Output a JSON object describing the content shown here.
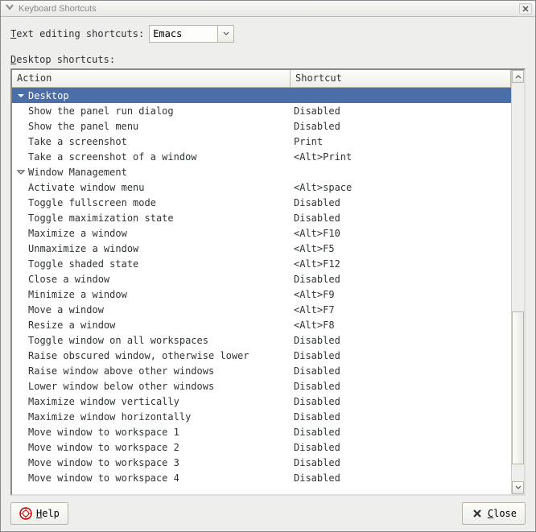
{
  "window": {
    "title": "Keyboard Shortcuts"
  },
  "editing": {
    "label": "Text editing shortcuts:",
    "dropdown_value": "Emacs"
  },
  "section": {
    "label": "Desktop shortcuts:"
  },
  "columns": {
    "action": "Action",
    "shortcut": "Shortcut"
  },
  "tree": [
    {
      "type": "group",
      "expanded": true,
      "selected": true,
      "label": "Desktop"
    },
    {
      "type": "item",
      "label": "Show the panel run dialog",
      "shortcut": "Disabled"
    },
    {
      "type": "item",
      "label": "Show the panel menu",
      "shortcut": "Disabled"
    },
    {
      "type": "item",
      "label": "Take a screenshot",
      "shortcut": "Print"
    },
    {
      "type": "item",
      "label": "Take a screenshot of a window",
      "shortcut": "<Alt>Print"
    },
    {
      "type": "group",
      "expanded": true,
      "selected": false,
      "label": "Window Management"
    },
    {
      "type": "item",
      "label": "Activate window menu",
      "shortcut": "<Alt>space"
    },
    {
      "type": "item",
      "label": "Toggle fullscreen mode",
      "shortcut": "Disabled"
    },
    {
      "type": "item",
      "label": "Toggle maximization state",
      "shortcut": "Disabled"
    },
    {
      "type": "item",
      "label": "Maximize a window",
      "shortcut": "<Alt>F10"
    },
    {
      "type": "item",
      "label": "Unmaximize a window",
      "shortcut": "<Alt>F5"
    },
    {
      "type": "item",
      "label": "Toggle shaded state",
      "shortcut": "<Alt>F12"
    },
    {
      "type": "item",
      "label": "Close a window",
      "shortcut": "Disabled"
    },
    {
      "type": "item",
      "label": "Minimize a window",
      "shortcut": "<Alt>F9"
    },
    {
      "type": "item",
      "label": "Move a window",
      "shortcut": "<Alt>F7"
    },
    {
      "type": "item",
      "label": "Resize a window",
      "shortcut": "<Alt>F8"
    },
    {
      "type": "item",
      "label": "Toggle window on all workspaces",
      "shortcut": "Disabled"
    },
    {
      "type": "item",
      "label": "Raise obscured window, otherwise lower",
      "shortcut": "Disabled"
    },
    {
      "type": "item",
      "label": "Raise window above other windows",
      "shortcut": "Disabled"
    },
    {
      "type": "item",
      "label": "Lower window below other windows",
      "shortcut": "Disabled"
    },
    {
      "type": "item",
      "label": "Maximize window vertically",
      "shortcut": "Disabled"
    },
    {
      "type": "item",
      "label": "Maximize window horizontally",
      "shortcut": "Disabled"
    },
    {
      "type": "item",
      "label": "Move window to workspace 1",
      "shortcut": "Disabled"
    },
    {
      "type": "item",
      "label": "Move window to workspace 2",
      "shortcut": "Disabled"
    },
    {
      "type": "item",
      "label": "Move window to workspace 3",
      "shortcut": "Disabled"
    },
    {
      "type": "item",
      "label": "Move window to workspace 4",
      "shortcut": "Disabled"
    }
  ],
  "footer": {
    "help": "Help",
    "close": "Close"
  }
}
